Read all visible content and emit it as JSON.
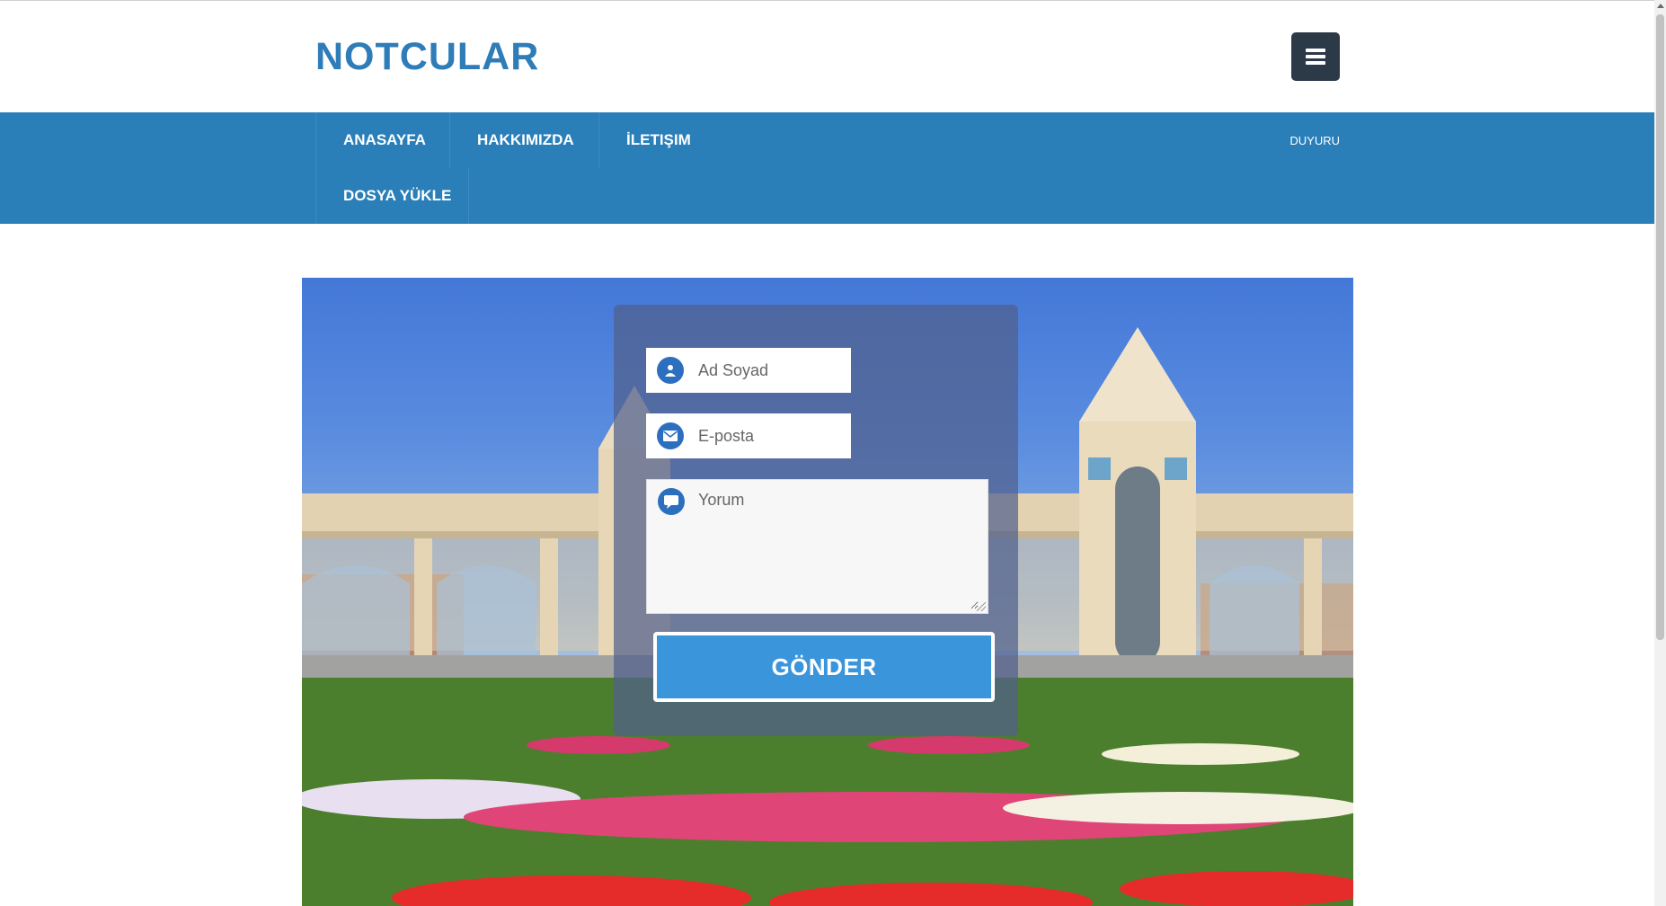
{
  "header": {
    "brand": "NOTCULAR",
    "menu_icon": "hamburger-icon"
  },
  "nav": {
    "items": [
      {
        "label": "ANASAYFA"
      },
      {
        "label": "HAKKIMIZDA"
      },
      {
        "label": "İLETIŞIM"
      },
      {
        "label": "DOSYA YÜKLE"
      }
    ],
    "announcement": "DUYURU"
  },
  "form": {
    "name_placeholder": "Ad Soyad",
    "email_placeholder": "E-posta",
    "comment_placeholder": "Yorum",
    "submit_label": "GÖNDER",
    "icons": [
      "user-icon",
      "envelope-icon",
      "chat-bubble-icon"
    ]
  },
  "colors": {
    "brand": "#2e7cb8",
    "nav_bg": "#2a7fb9",
    "menu_button": "#2c3a47",
    "submit": "#3a95db",
    "icon_circle": "#2d6fbf"
  }
}
